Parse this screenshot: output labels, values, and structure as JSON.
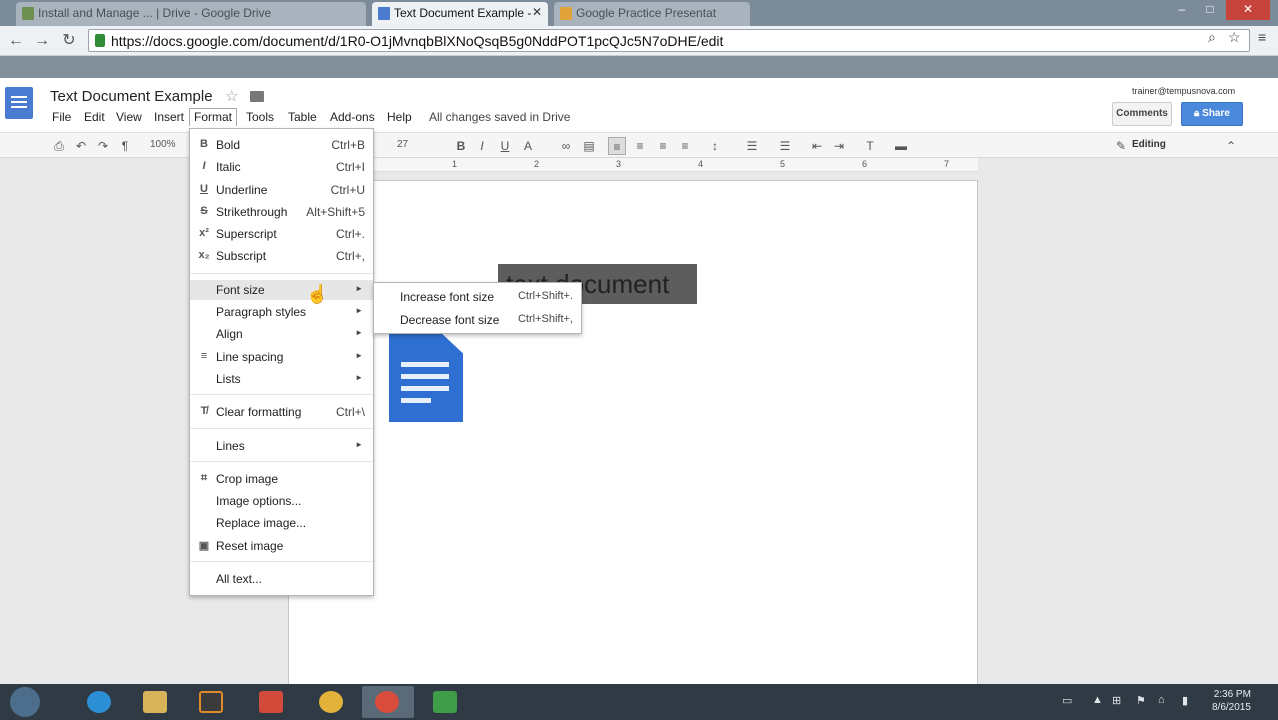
{
  "browser": {
    "tabs": [
      {
        "label": "Install and Manage ... | Drive - Google Drive",
        "active": false
      },
      {
        "label": "Text Document Example -",
        "active": true
      },
      {
        "label": "Google Practice Presentat",
        "active": false
      }
    ],
    "url": "https://docs.google.com/document/d/1R0-O1jMvnqbBlXNoQsqB5g0NddPOT1pcQJc5N7oDHE/edit"
  },
  "docs": {
    "title": "Text Document Example",
    "menu": [
      "File",
      "Edit",
      "View",
      "Insert",
      "Format",
      "Tools",
      "Table",
      "Add-ons",
      "Help"
    ],
    "saved_status": "All changes saved in Drive",
    "user_email": "trainer@tempusnova.com",
    "comments_label": "Comments",
    "share_label": "Share",
    "zoom": "100%",
    "font_size": "27",
    "editing_mode": "Editing",
    "ruler_numbers": [
      "1",
      "2",
      "3",
      "4",
      "5",
      "6",
      "7"
    ]
  },
  "format_menu": {
    "items": [
      {
        "label": "Bold",
        "shortcut": "Ctrl+B",
        "icon": "B"
      },
      {
        "label": "Italic",
        "shortcut": "Ctrl+I",
        "icon": "I"
      },
      {
        "label": "Underline",
        "shortcut": "Ctrl+U",
        "icon": "U"
      },
      {
        "label": "Strikethrough",
        "shortcut": "Alt+Shift+5",
        "icon": "S"
      },
      {
        "label": "Superscript",
        "shortcut": "Ctrl+.",
        "icon": "x²"
      },
      {
        "label": "Subscript",
        "shortcut": "Ctrl+,",
        "icon": "x₂"
      },
      {
        "label": "Font size",
        "shortcut": "",
        "icon": ""
      },
      {
        "label": "Paragraph styles",
        "shortcut": "",
        "icon": ""
      },
      {
        "label": "Align",
        "shortcut": "",
        "icon": ""
      },
      {
        "label": "Line spacing",
        "shortcut": "",
        "icon": "≡"
      },
      {
        "label": "Lists",
        "shortcut": "",
        "icon": ""
      },
      {
        "label": "Clear formatting",
        "shortcut": "Ctrl+\\",
        "icon": "T̸"
      },
      {
        "label": "Lines",
        "shortcut": "",
        "icon": ""
      },
      {
        "label": "Crop image",
        "shortcut": "",
        "icon": "⌗"
      },
      {
        "label": "Image options...",
        "shortcut": "",
        "icon": ""
      },
      {
        "label": "Replace image...",
        "shortcut": "",
        "icon": ""
      },
      {
        "label": "Reset image",
        "shortcut": "",
        "icon": "▣"
      },
      {
        "label": "All text...",
        "shortcut": "",
        "icon": ""
      }
    ]
  },
  "font_size_submenu": {
    "items": [
      {
        "label": "Increase font size",
        "shortcut": "Ctrl+Shift+."
      },
      {
        "label": "Decrease font size",
        "shortcut": "Ctrl+Shift+,"
      }
    ]
  },
  "document": {
    "selected_text": "text document"
  },
  "taskbar": {
    "time": "2:36 PM",
    "date": "8/6/2015"
  }
}
